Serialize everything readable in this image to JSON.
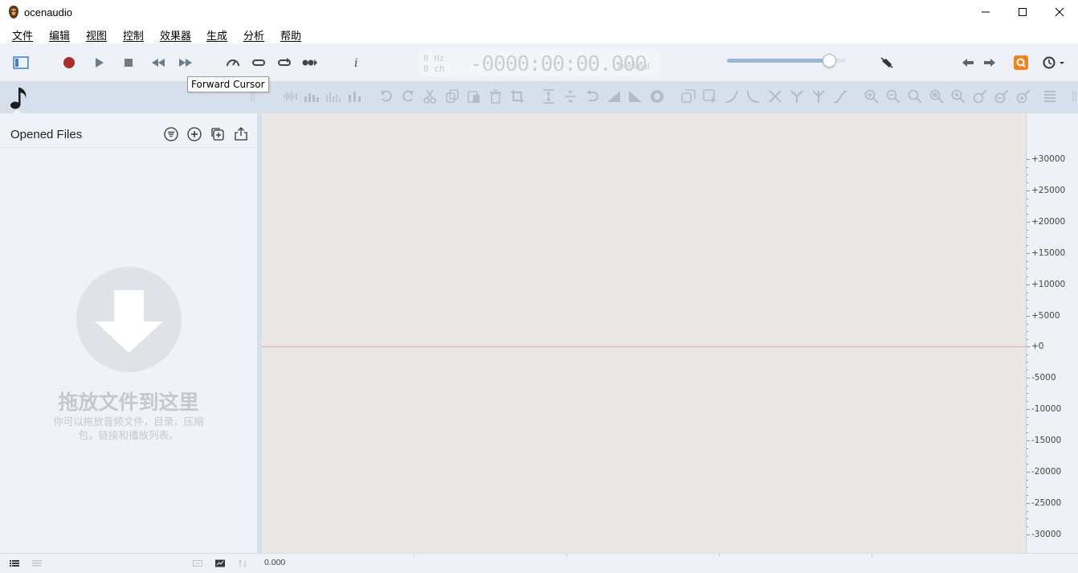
{
  "window": {
    "title": "ocenaudio",
    "controls": [
      "minimize-icon",
      "maximize-icon",
      "close-icon"
    ]
  },
  "menu": [
    "文件",
    "编辑",
    "视图",
    "控制",
    "效果器",
    "生成",
    "分析",
    "帮助"
  ],
  "transport": {
    "icons": [
      "sidebar-toggle-icon",
      "record-icon",
      "play-icon",
      "stop-icon",
      "rewind-icon",
      "fast-forward-icon",
      "speed-icon",
      "loop-icon",
      "loop-alt-icon",
      "forward-cursor-icon",
      "info-icon"
    ]
  },
  "tooltip": "Forward Cursor",
  "display": {
    "frequency": "0 Hz",
    "channels": "0 ch",
    "time": "-0000:00:00.000",
    "format": "Decimal"
  },
  "volume": {
    "level": 0.86
  },
  "colors": {
    "accent": "#9db6d6",
    "record": "#a7302f",
    "orange_button": "#f2821d",
    "center_line": "#d9a9a4"
  },
  "sidebar": {
    "title": "Opened Files",
    "header_icons": [
      "filter-icon",
      "add-icon",
      "duplicate-icon",
      "export-icon"
    ],
    "drop_title": "拖放文件到这里",
    "drop_subtitle": "你可以拖放音频文件，目录，压缩包，链接和播放列表。"
  },
  "waveform": {
    "y_labels": [
      "+30000",
      "+25000",
      "+20000",
      "+15000",
      "+10000",
      "+5000",
      "+0",
      "-5000",
      "-10000",
      "-15000",
      "-20000",
      "-25000",
      "-30000"
    ]
  },
  "timeline": {
    "start": "0.000"
  }
}
